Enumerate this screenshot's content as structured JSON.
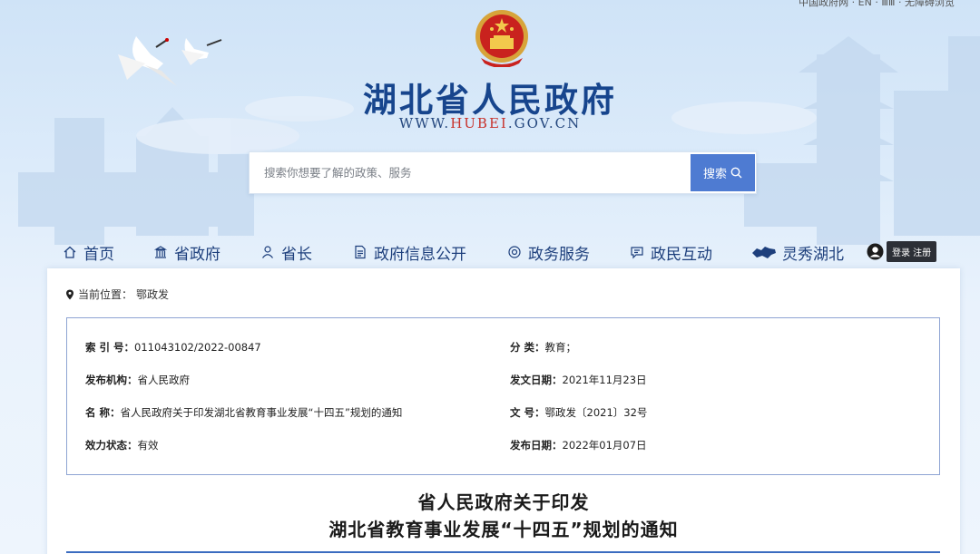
{
  "header": {
    "top_links": "中国政府网 · EN · ⅢⅢ · 无障碍浏览",
    "site_title": "湖北省人民政府",
    "site_url_prefix": "WWW.",
    "site_url_highlight": "HUBEI",
    "site_url_suffix": ".GOV.CN"
  },
  "search": {
    "placeholder": "搜索你想要了解的政策、服务",
    "button_label": "搜索"
  },
  "nav": {
    "items": [
      {
        "label": "首页",
        "icon": "home-icon"
      },
      {
        "label": "省政府",
        "icon": "building-icon"
      },
      {
        "label": "省长",
        "icon": "person-icon"
      },
      {
        "label": "政府信息公开",
        "icon": "document-icon"
      },
      {
        "label": "政务服务",
        "icon": "service-icon"
      },
      {
        "label": "政民互动",
        "icon": "chat-icon"
      },
      {
        "label": "灵秀湖北",
        "icon": "hubei-map-icon"
      }
    ],
    "login_label": "登录 注册"
  },
  "breadcrumb": {
    "prefix": "当前位置：",
    "current": "鄂政发"
  },
  "meta": {
    "index_label": "索 引 号：",
    "index_value": "011043102/2022-00847",
    "category_label": "分 类：",
    "category_value": "教育；",
    "publisher_label": "发布机构：",
    "publisher_value": "省人民政府",
    "issue_date_label": "发文日期：",
    "issue_date_value": "2021年11月23日",
    "name_label": "名 称：",
    "name_value": "省人民政府关于印发湖北省教育事业发展“十四五”规划的通知",
    "doc_no_label": "文 号：",
    "doc_no_value": "鄂政发〔2021〕32号",
    "status_label": "效力状态：",
    "status_value": "有效",
    "publish_date_label": "发布日期：",
    "publish_date_value": "2022年01月07日"
  },
  "document": {
    "title_line1": "省人民政府关于印发",
    "title_line2": "湖北省教育事业发展“十四五”规划的通知"
  },
  "colors": {
    "title_blue": "#17458d",
    "url_red": "#c8322b",
    "search_button": "#4e7bd2",
    "nav_text": "#1d3f7c",
    "meta_border": "#8ea4d3"
  }
}
